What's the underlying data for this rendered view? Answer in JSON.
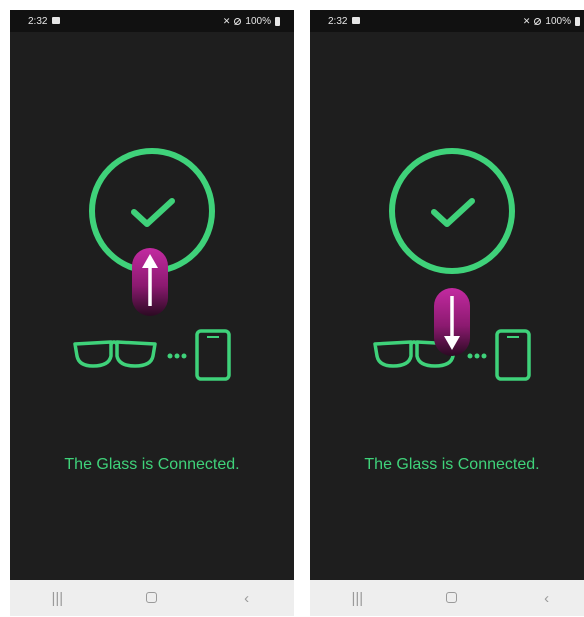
{
  "screens": [
    {
      "status_bar": {
        "time": "2:32",
        "battery": "100%"
      },
      "message": "The Glass is Connected.",
      "swipe_gesture": "swipe-up"
    },
    {
      "status_bar": {
        "time": "2:32",
        "battery": "100%"
      },
      "message": "The Glass is Connected.",
      "swipe_gesture": "swipe-down"
    }
  ],
  "colors": {
    "screen_background": "#1e1e1e",
    "accent_green": "#3fd27a",
    "status_bar_background": "#111111",
    "nav_bar_background": "#eeeeee",
    "gesture_pill": "#c32aa1"
  },
  "icons": {
    "check": "check-icon",
    "glasses": "glasses-icon",
    "phone": "phone-icon",
    "nav_recents": "recents-icon",
    "nav_home": "home-icon",
    "nav_back": "back-icon"
  }
}
